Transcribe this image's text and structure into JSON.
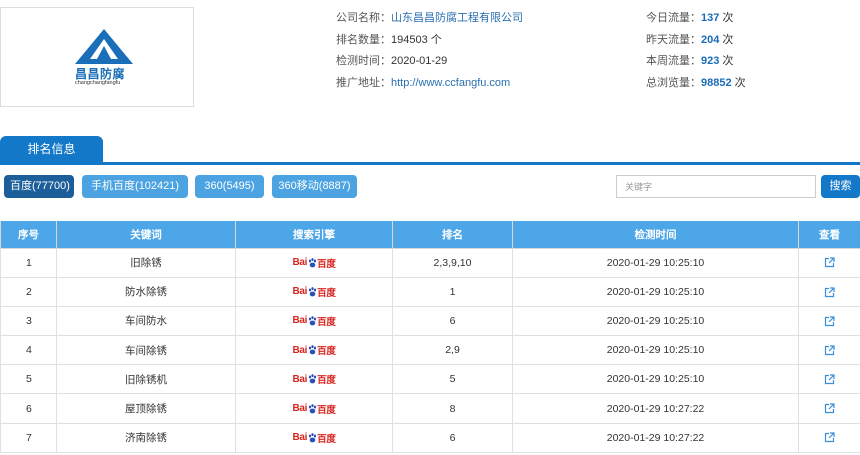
{
  "logo": {
    "brand": "昌昌防腐",
    "sub": "changchangfangfu",
    "color": "#1b6fb8"
  },
  "company": {
    "name_label": "公司名称：",
    "name": "山东昌昌防腐工程有限公司",
    "rank_label": "排名数量：",
    "rank_count": "194503 个",
    "check_label": "检测时间：",
    "check_date": "2020-01-29",
    "url_label": "推广地址：",
    "url": "http://www.ccfangfu.com"
  },
  "stats": {
    "today_label": "今日流量：",
    "today": "137",
    "yesterday_label": "昨天流量：",
    "yesterday": "204",
    "week_label": "本周流量：",
    "week": "923",
    "total_label": "总浏览量：",
    "total": "98852",
    "unit": "次"
  },
  "tab": {
    "label": "排名信息"
  },
  "filters": [
    {
      "label": "百度(77700)",
      "active": true
    },
    {
      "label": "手机百度(102421)",
      "active": false
    },
    {
      "label": "360(5495)",
      "active": false
    },
    {
      "label": "360移动(8887)",
      "active": false
    }
  ],
  "search": {
    "placeholder": "关键字",
    "button": "搜索"
  },
  "table": {
    "headers": [
      "序号",
      "关键词",
      "搜索引擎",
      "排名",
      "检测时间",
      "查看"
    ],
    "rows": [
      {
        "idx": "1",
        "keyword": "旧除锈",
        "rank": "2,3,9,10",
        "time": "2020-01-29 10:25:10"
      },
      {
        "idx": "2",
        "keyword": "防水除锈",
        "rank": "1",
        "time": "2020-01-29 10:25:10"
      },
      {
        "idx": "3",
        "keyword": "车间防水",
        "rank": "6",
        "time": "2020-01-29 10:25:10"
      },
      {
        "idx": "4",
        "keyword": "车间除锈",
        "rank": "2,9",
        "time": "2020-01-29 10:25:10"
      },
      {
        "idx": "5",
        "keyword": "旧除锈机",
        "rank": "5",
        "time": "2020-01-29 10:25:10"
      },
      {
        "idx": "6",
        "keyword": "屋顶除锈",
        "rank": "8",
        "time": "2020-01-29 10:27:22"
      },
      {
        "idx": "7",
        "keyword": "济南除锈",
        "rank": "6",
        "time": "2020-01-29 10:27:22"
      }
    ]
  },
  "engine_logo": {
    "prefix": "Bai",
    "suffix": "百度"
  },
  "icons": {
    "engine": "baidu-logo-icon",
    "view": "external-link-icon"
  }
}
